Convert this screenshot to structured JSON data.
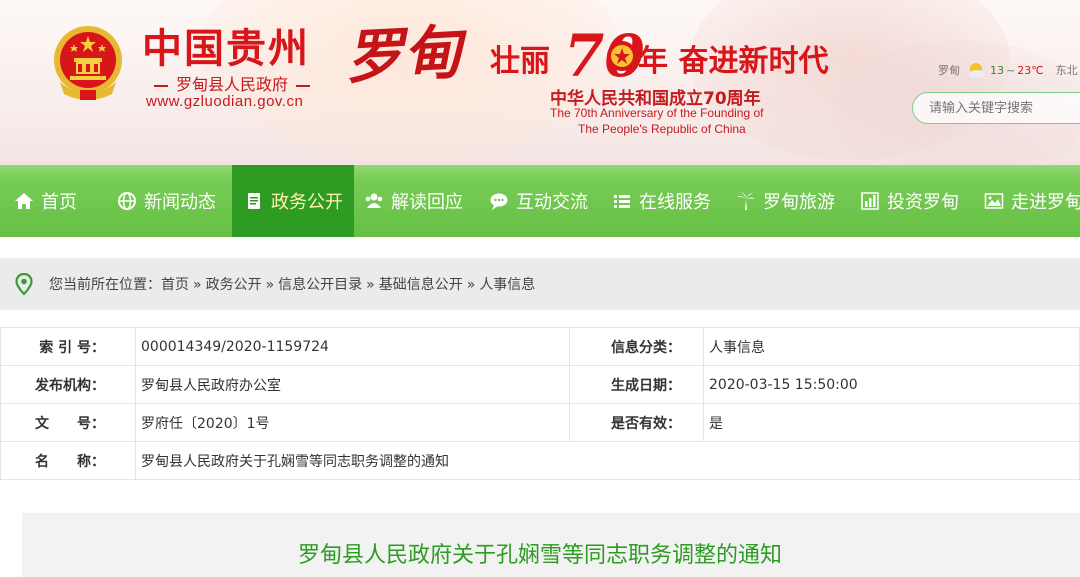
{
  "header": {
    "site_title": "中国贵州",
    "calligraphy": "罗甸",
    "subtitle": "罗甸县人民政府",
    "url": "www.gzluodian.gov.cn",
    "slogan_part1": "壮丽",
    "slogan_number": "70",
    "slogan_part2": "年 奋进新时代",
    "anniversary_cn": "中华人民共和国成立70周年",
    "anniversary_en_line1": "The 70th Anniversary of the Founding of",
    "anniversary_en_line2": "The People's Republic of China",
    "weather": {
      "city": "罗甸",
      "low": "13",
      "separator": "~",
      "high": "23℃",
      "next_city": "东北"
    },
    "search_placeholder": "请输入关键字搜索"
  },
  "nav": {
    "items": [
      {
        "label": "首页",
        "icon": "home-icon"
      },
      {
        "label": "新闻动态",
        "icon": "globe-icon"
      },
      {
        "label": "政务公开",
        "icon": "document-icon",
        "active": true
      },
      {
        "label": "解读回应",
        "icon": "people-icon"
      },
      {
        "label": "互动交流",
        "icon": "chat-icon"
      },
      {
        "label": "在线服务",
        "icon": "list-icon"
      },
      {
        "label": "罗甸旅游",
        "icon": "palm-tree-icon"
      },
      {
        "label": "投资罗甸",
        "icon": "bar-chart-icon"
      },
      {
        "label": "走进罗甸",
        "icon": "picture-icon"
      }
    ]
  },
  "breadcrumb": {
    "prefix": "您当前所在位置：",
    "separator": "»",
    "items": [
      "首页",
      "政务公开",
      "信息公开目录",
      "基础信息公开",
      "人事信息"
    ]
  },
  "info": {
    "index_label": "索 引 号：",
    "index_value": "000014349/2020-1159724",
    "category_label": "信息分类：",
    "category_value": "人事信息",
    "publisher_label": "发布机构：",
    "publisher_value": "罗甸县人民政府办公室",
    "date_label": "生成日期：",
    "date_value": "2020-03-15 15:50:00",
    "doc_no_label": "文　　号：",
    "doc_no_value": "罗府任〔2020〕1号",
    "valid_label": "是否有效：",
    "valid_value": "是",
    "name_label": "名　　称：",
    "name_value": "罗甸县人民政府关于孔娴雪等同志职务调整的通知"
  },
  "article": {
    "title": "罗甸县人民政府关于孔娴雪等同志职务调整的通知"
  },
  "colors": {
    "brand_red": "#d8161a",
    "nav_green": "#6cc44b",
    "nav_active": "#2e9b23",
    "title_green": "#2e9b23"
  }
}
